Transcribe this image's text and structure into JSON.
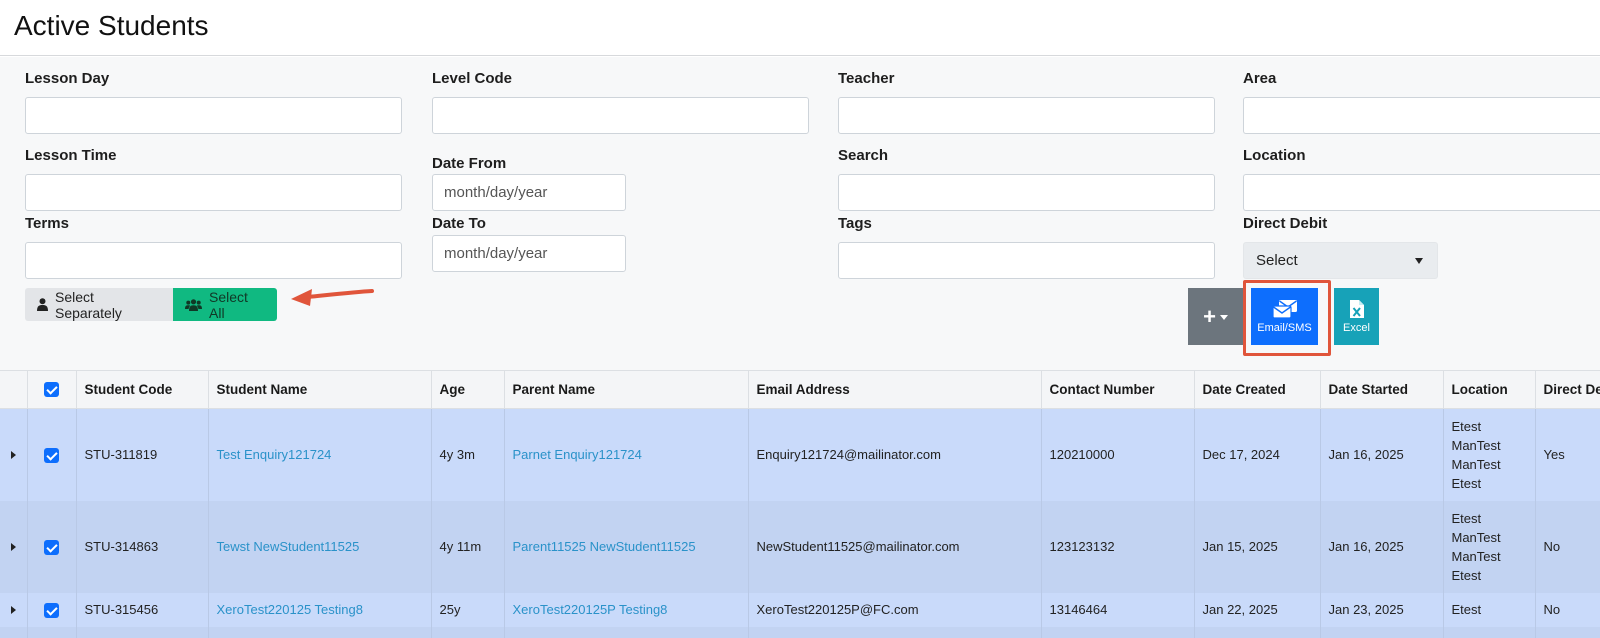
{
  "page": {
    "title": "Active Students"
  },
  "filters": {
    "lesson_day": {
      "label": "Lesson Day",
      "value": ""
    },
    "level_code": {
      "label": "Level Code",
      "value": ""
    },
    "teacher": {
      "label": "Teacher",
      "value": ""
    },
    "area": {
      "label": "Area",
      "value": ""
    },
    "lesson_time": {
      "label": "Lesson Time",
      "value": ""
    },
    "date_from": {
      "label": "Date From",
      "placeholder": "month/day/year"
    },
    "search": {
      "label": "Search",
      "value": ""
    },
    "location": {
      "label": "Location",
      "value": ""
    },
    "terms": {
      "label": "Terms",
      "value": ""
    },
    "date_to": {
      "label": "Date To",
      "placeholder": "month/day/year"
    },
    "tags": {
      "label": "Tags",
      "value": ""
    },
    "direct_debit": {
      "label": "Direct Debit",
      "selected": "Select"
    }
  },
  "selection_mode": {
    "separately_label": "Select Separately",
    "all_label": "Select All",
    "active": "Select All"
  },
  "toolbar": {
    "add_label": "+",
    "email_sms_label": "Email/SMS",
    "excel_label": "Excel"
  },
  "table": {
    "columns": [
      "Student Code",
      "Student Name",
      "Age",
      "Parent Name",
      "Email Address",
      "Contact Number",
      "Date Created",
      "Date Started",
      "Location",
      "Direct De"
    ],
    "rows": [
      {
        "checked": true,
        "student_code": "STU-311819",
        "student_name": "Test Enquiry121724",
        "age": "4y 3m",
        "parent_name": "Parnet Enquiry121724",
        "email": "Enquiry121724@mailinator.com",
        "contact": "120210000",
        "date_created": "Dec 17, 2024",
        "date_started": "Jan 16, 2025",
        "location": [
          "Etest",
          "ManTest",
          "ManTest",
          "Etest"
        ],
        "direct_debit": "Yes"
      },
      {
        "checked": true,
        "student_code": "STU-314863",
        "student_name": "Tewst NewStudent11525",
        "age": "4y 11m",
        "parent_name": "Parent11525 NewStudent11525",
        "email": "NewStudent11525@mailinator.com",
        "contact": "123123132",
        "date_created": "Jan 15, 2025",
        "date_started": "Jan 16, 2025",
        "location": [
          "Etest",
          "ManTest",
          "ManTest",
          "Etest"
        ],
        "direct_debit": "No"
      },
      {
        "checked": true,
        "student_code": "STU-315456",
        "student_name": "XeroTest220125 Testing8",
        "age": "25y",
        "parent_name": "XeroTest220125P Testing8",
        "email": "XeroTest220125P@FC.com",
        "contact": "13146464",
        "date_created": "Jan 22, 2025",
        "date_started": "Jan 23, 2025",
        "location": [
          "Etest"
        ],
        "direct_debit": "No"
      }
    ]
  },
  "colors": {
    "primary": "#0d6efd",
    "success": "#10b981",
    "info": "#17a2b8",
    "secondary": "#6c757d",
    "highlight_frame": "#e0553b",
    "row_selected": "#c9dafa",
    "link": "#2a92c9"
  }
}
